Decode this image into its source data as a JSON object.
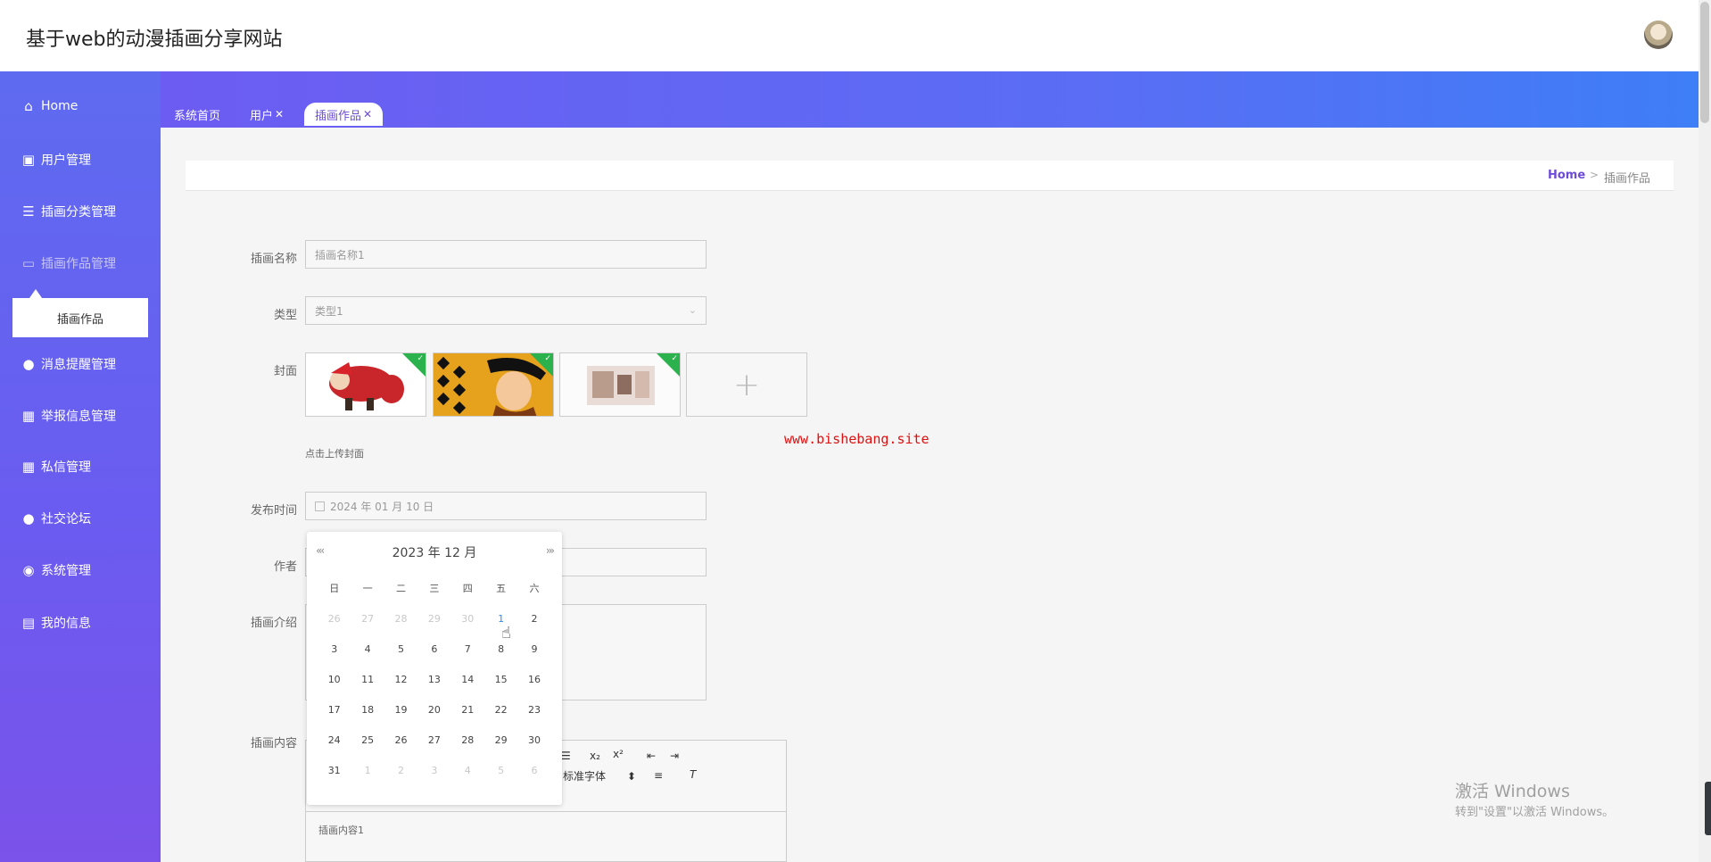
{
  "header": {
    "site_title": "基于web的动漫插画分享网站"
  },
  "sidebar": {
    "items": [
      {
        "label": "Home",
        "icon": "home-icon"
      },
      {
        "label": "用户管理",
        "icon": "user-card-icon"
      },
      {
        "label": "插画分类管理",
        "icon": "list-icon"
      },
      {
        "label": "插画作品管理",
        "icon": "monitor-icon"
      },
      {
        "label": "消息提醒管理",
        "icon": "person-icon"
      },
      {
        "label": "举报信息管理",
        "icon": "grid-icon"
      },
      {
        "label": "私信管理",
        "icon": "grid-icon"
      },
      {
        "label": "社交论坛",
        "icon": "person-icon"
      },
      {
        "label": "系统管理",
        "icon": "bulb-icon"
      },
      {
        "label": "我的信息",
        "icon": "window-icon"
      }
    ],
    "submenu": {
      "label": "插画作品"
    }
  },
  "tabs": [
    {
      "label": "系统首页",
      "closable": false
    },
    {
      "label": "用户",
      "closable": true
    },
    {
      "label": "插画作品",
      "closable": true,
      "active": true
    }
  ],
  "breadcrumb": {
    "home": "Home",
    "separator": ">",
    "current": "插画作品"
  },
  "form": {
    "name": {
      "label": "插画名称",
      "value": "插画名称1"
    },
    "type": {
      "label": "类型",
      "value": "类型1"
    },
    "cover": {
      "label": "封面",
      "hint": "点击上传封面",
      "add": "+"
    },
    "publish_time": {
      "label": "发布时间",
      "value": "2024 年 01 月 10 日"
    },
    "author": {
      "label": "作者"
    },
    "intro": {
      "label": "插画介绍"
    },
    "content": {
      "label": "插画内容",
      "value": "插画内容1",
      "font_select": "标准字体"
    }
  },
  "watermark_link": "www.bishebang.site",
  "datepicker": {
    "prev": "«‹",
    "next": "›»",
    "title": "2023 年  12 月",
    "weekdays": [
      "日",
      "一",
      "二",
      "三",
      "四",
      "五",
      "六"
    ],
    "weeks": [
      [
        "26",
        "27",
        "28",
        "29",
        "30",
        "1",
        "2"
      ],
      [
        "3",
        "4",
        "5",
        "6",
        "7",
        "8",
        "9"
      ],
      [
        "10",
        "11",
        "12",
        "13",
        "14",
        "15",
        "16"
      ],
      [
        "17",
        "18",
        "19",
        "20",
        "21",
        "22",
        "23"
      ],
      [
        "24",
        "25",
        "26",
        "27",
        "28",
        "29",
        "30"
      ],
      [
        "31",
        "1",
        "2",
        "3",
        "4",
        "5",
        "6"
      ]
    ]
  },
  "editor_toolbar": {
    "sub": "x₂",
    "sup": "x²"
  },
  "windows_watermark": {
    "line1": "激活 Windows",
    "line2": "转到\"设置\"以激活 Windows。"
  },
  "colors": {
    "accent": "#6d4cd8",
    "sidebar_top": "#5e6bf0",
    "sidebar_bottom": "#7b52ea",
    "corner_badge": "#2bb24c",
    "link_red": "#e01010"
  }
}
